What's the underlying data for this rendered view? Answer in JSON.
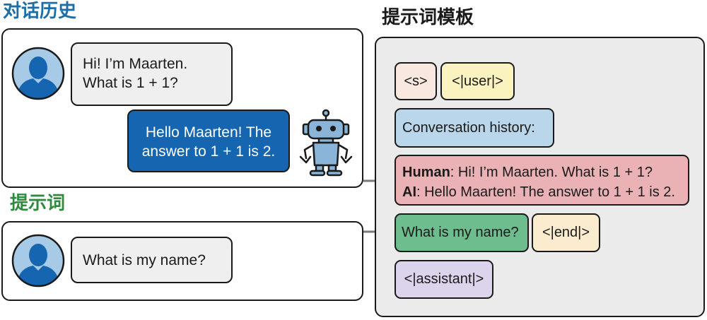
{
  "conversation_history": {
    "title": "对话历史",
    "user_message": {
      "line1": "Hi! I’m Maarten.",
      "line2": "What is 1 + 1?"
    },
    "ai_message": {
      "line1": "Hello Maarten! The",
      "line2": "answer to 1 + 1 is 2."
    }
  },
  "prompt": {
    "title": "提示词",
    "user_message": "What is my name?"
  },
  "template": {
    "title": "提示词模板",
    "tokens": {
      "start": "<s>",
      "user": "<|user|>",
      "conversation_history": "Conversation history:",
      "human_label": "Human",
      "human_text": ": Hi! I’m Maarten. What is 1 + 1?",
      "ai_label": "AI",
      "ai_text": ": Hello Maarten! The answer to 1 + 1 is 2.",
      "question": "What is my name?",
      "end": "<|end|>",
      "assistant": "<|assistant|>"
    }
  },
  "colors": {
    "history_title": "#1c6ea8",
    "prompt_title": "#2e8b3d",
    "template_panel": "#ebebeb",
    "user_bubble": "#efefef",
    "ai_bubble": "#1565b0",
    "avatar_bg": "#a7cbe6",
    "avatar_fg": "#1565b0",
    "chip_s": "#f8e8df",
    "chip_user": "#fbf3bf",
    "chip_history": "#b9d6ea",
    "chip_human": "#ebb2b6",
    "chip_question": "#6dbd8f",
    "chip_end": "#fbecd0",
    "chip_assistant": "#dcd3ec",
    "arrow": "#7a7a7a"
  }
}
